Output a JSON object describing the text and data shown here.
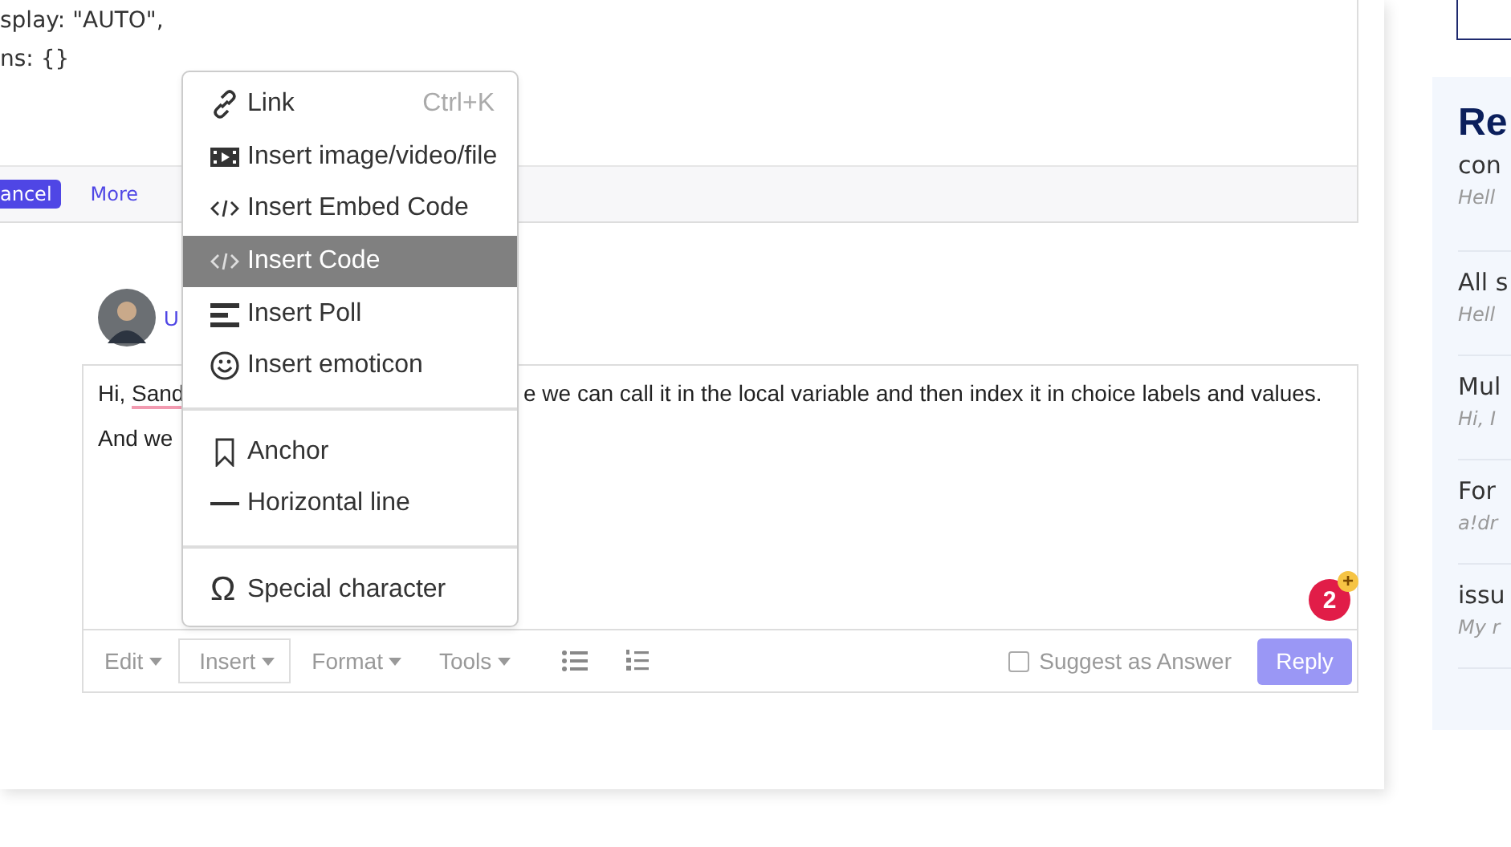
{
  "code_card": {
    "lines": [
      "splay: \"AUTO\",",
      "ns: {}"
    ],
    "cancel_button": "ancel",
    "more_link": "More"
  },
  "comment": {
    "author": "U"
  },
  "editor": {
    "lines": [
      {
        "left": "Hi, ",
        "misspelled": "Sand",
        "right": "e we can call it in the local variable and then index it in choice labels and values."
      },
      {
        "left": "And we"
      }
    ],
    "badge": {
      "count": "2",
      "plus": "+"
    },
    "toolbar": {
      "menus": [
        {
          "label": "Edit",
          "selected": false
        },
        {
          "label": "Insert",
          "selected": true
        },
        {
          "label": "Format",
          "selected": false
        },
        {
          "label": "Tools",
          "selected": false
        }
      ],
      "suggest": {
        "label": "Suggest as Answer",
        "checked": false
      },
      "reply": "Reply"
    }
  },
  "insert_menu": {
    "sections": [
      [
        {
          "kind": "link",
          "label": "Link",
          "shortcut": "Ctrl+K",
          "selected": false
        },
        {
          "kind": "media",
          "label": "Insert image/video/file",
          "selected": false
        },
        {
          "kind": "code",
          "label": "Insert Embed Code",
          "selected": false
        },
        {
          "kind": "code",
          "label": "Insert Code",
          "selected": true
        },
        {
          "kind": "poll",
          "label": "Insert Poll",
          "selected": false
        },
        {
          "kind": "emoticon",
          "label": "Insert emoticon",
          "selected": false
        }
      ],
      [
        {
          "kind": "anchor",
          "label": "Anchor",
          "selected": false
        },
        {
          "kind": "rule",
          "label": "Horizontal line",
          "selected": false
        }
      ],
      [
        {
          "kind": "symbol",
          "icon_text": "Ω",
          "label": "Special character",
          "selected": false
        }
      ]
    ]
  },
  "sidebar": {
    "heading": "Re",
    "items": [
      {
        "title": "con",
        "snippet": "Hell"
      },
      {
        "title": "All s",
        "snippet": "Hell"
      },
      {
        "title": "Mul",
        "snippet": "Hi, I"
      },
      {
        "title": "For",
        "snippet": "a!dr"
      },
      {
        "title": "issu",
        "snippet": "My r"
      }
    ]
  }
}
